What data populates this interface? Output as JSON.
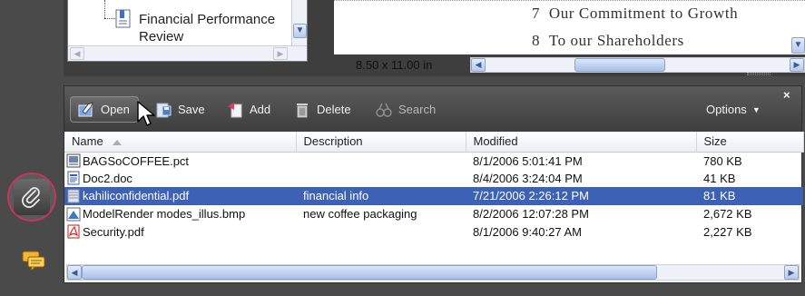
{
  "bookmarks": {
    "item_label": "Financial Performance Review"
  },
  "document": {
    "page_size": "8.50 x 11.00 in",
    "toc": [
      {
        "num": "7",
        "title": "Our Commitment to Growth"
      },
      {
        "num": "8",
        "title": "To our Shareholders"
      }
    ]
  },
  "attachments": {
    "toolbar": {
      "open": "Open",
      "save": "Save",
      "add": "Add",
      "delete": "Delete",
      "search": "Search",
      "options": "Options",
      "close": "×"
    },
    "columns": [
      "Name",
      "Description",
      "Modified",
      "Size"
    ],
    "files": [
      {
        "name": "BAGSoCOFFEE.pct",
        "description": "",
        "modified": "8/1/2006 5:01:41 PM",
        "size": "780 KB",
        "icon": "image-file-icon"
      },
      {
        "name": "Doc2.doc",
        "description": "",
        "modified": "8/4/2006 3:24:04 PM",
        "size": "41 KB",
        "icon": "word-file-icon"
      },
      {
        "name": "kahiliconfidential.pdf",
        "description": "financial info",
        "modified": "7/21/2006 2:26:12 PM",
        "size": "81 KB",
        "icon": "secure-pdf-file-icon"
      },
      {
        "name": "ModelRender modes_illus.bmp",
        "description": "new coffee packaging",
        "modified": "8/2/2006 12:07:28 PM",
        "size": "2,672 KB",
        "icon": "bitmap-file-icon"
      },
      {
        "name": "Security.pdf",
        "description": "",
        "modified": "8/1/2006 9:40:27 AM",
        "size": "2,227 KB",
        "icon": "pdf-file-icon"
      }
    ],
    "selected_index": 2
  },
  "colors": {
    "selection": "#3c61b5",
    "highlight_ring": "#c8345a",
    "panel_dark": "#4a4a4a"
  }
}
